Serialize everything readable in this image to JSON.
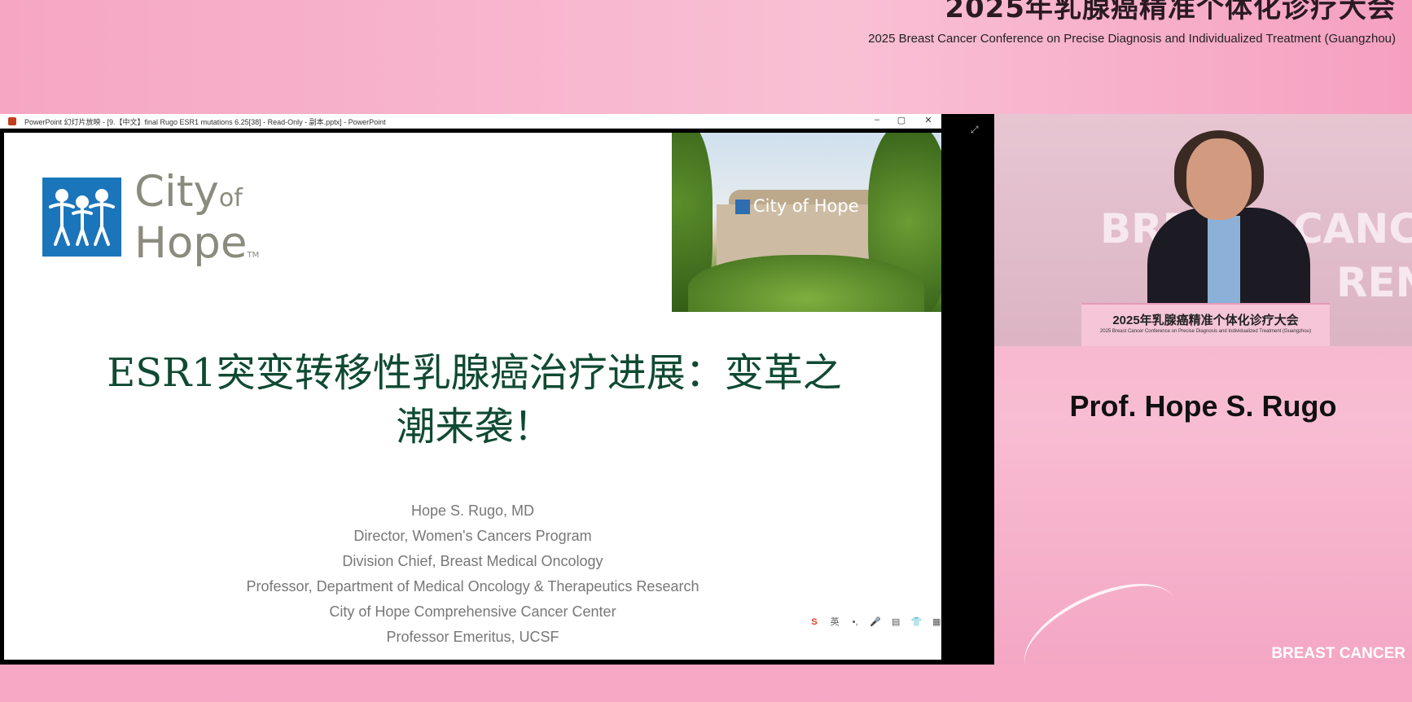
{
  "banner": {
    "title": "2025年乳腺癌精准个体化诊疗大会",
    "subtitle": "2025 Breast Cancer Conference on Precise Diagnosis and Individualized Treatment (Guangzhou)"
  },
  "ppt_window": {
    "title": "PowerPoint 幻灯片放映 - [9.【中文】final Rugo ESR1 mutations 6.25[38] - Read-Only - 副本.pptx] - PowerPoint",
    "controls": {
      "minimize": "–",
      "restore": "▢",
      "close": "✕"
    }
  },
  "slide": {
    "logo": {
      "city": "City",
      "of": "of",
      "hope": "Hope",
      "tm": "TM"
    },
    "photo_sign": "City of Hope",
    "title_line1": "ESR1突变转移性乳腺癌治疗进展：变革之",
    "title_line2": "潮来袭！",
    "title_color": "#0f4a32",
    "credits": [
      "Hope S. Rugo, MD",
      "Director, Women's Cancers Program",
      "Division Chief, Breast Medical Oncology",
      "Professor, Department of Medical Oncology & Therapeutics Research",
      "City of Hope Comprehensive Cancer Center",
      "Professor Emeritus, UCSF"
    ]
  },
  "ime_toolbar": {
    "logo": "S",
    "items": [
      "英",
      "•,",
      "🎤",
      "▤",
      "👕",
      "▦",
      "⚙"
    ]
  },
  "speaker": {
    "video_bg_text": "BREAST CANC",
    "video_bg_text2": "REN",
    "podium_title": "2025年乳腺癌精准个体化诊疗大会",
    "podium_subtitle": "2025 Breast Cancer Conference on Precise Diagnosis and Individualized Treatment (Guangzhou)",
    "name": "Prof. Hope S. Rugo",
    "footer_brand": "BREAST CANCER"
  }
}
